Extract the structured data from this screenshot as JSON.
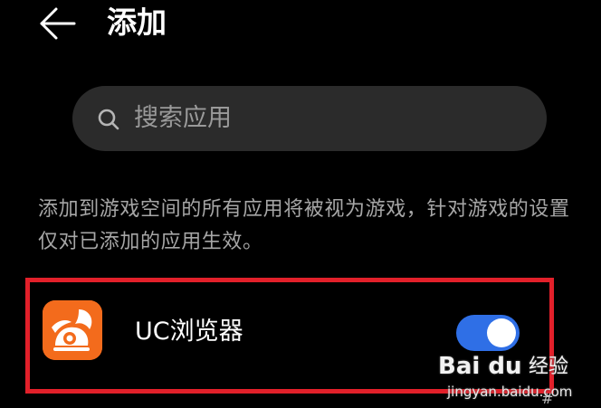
{
  "header": {
    "back_icon": "arrow-left-icon",
    "title": "添加"
  },
  "search": {
    "icon": "search-icon",
    "placeholder": "搜索应用"
  },
  "description": "添加到游戏空间的所有应用将被视为游戏，针对游戏的设置仅对已添加的应用生效。",
  "app_list": [
    {
      "name": "UC浏览器",
      "icon": "uc-browser-icon",
      "enabled": true
    }
  ],
  "colors": {
    "background": "#000000",
    "search_bg": "#2b2b2b",
    "toggle_on": "#2f6fe6",
    "highlight_border": "#e2202a",
    "app_icon_bg": "#f36b1c"
  },
  "watermark": {
    "brand": "Bai du",
    "product": "经验",
    "url": "jingyan.baidu.com",
    "mark": "#"
  }
}
